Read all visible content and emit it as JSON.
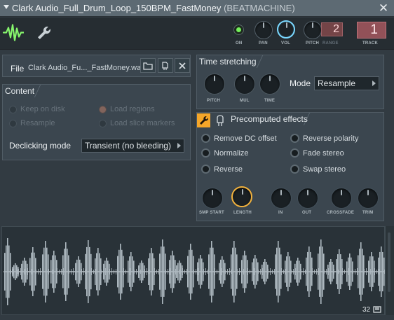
{
  "window": {
    "title": "Clark Audio_Full_Drum_Loop_150BPM_FastMoney",
    "subtitle": "(BEATMACHINE)",
    "close_symbol": "✕"
  },
  "topbar": {
    "on_label": "ON",
    "pan_label": "PAN",
    "vol_label": "VOL",
    "pitch_label": "PITCH",
    "range_label": "RANGE",
    "range_value": "2",
    "track_label": "TRACK",
    "track_value": "1",
    "icons": [
      "waveform-icon",
      "wrench-icon"
    ]
  },
  "file_panel": {
    "label": "File",
    "name": "Clark Audio_Fu..._FastMoney.wav",
    "buttons": [
      "folder-icon",
      "chip-icon",
      "close-icon"
    ]
  },
  "content_panel": {
    "title": "Content",
    "options": [
      {
        "label": "Keep on disk",
        "state": "disabled"
      },
      {
        "label": "Load regions",
        "state": "active-disabled"
      },
      {
        "label": "Resample",
        "state": "disabled"
      },
      {
        "label": "Load slice markers",
        "state": "disabled"
      }
    ],
    "declicking_label": "Declicking mode",
    "declicking_value": "Transient (no bleeding)"
  },
  "stretch_panel": {
    "title": "Time stretching",
    "knobs": [
      "PITCH",
      "MUL",
      "TIME"
    ],
    "mode_label": "Mode",
    "mode_value": "Resample"
  },
  "effects_panel": {
    "title": "Precomputed effects",
    "left_options": [
      "Remove DC offset",
      "Normalize",
      "Reverse"
    ],
    "right_options": [
      "Reverse polarity",
      "Fade stereo",
      "Swap stereo"
    ],
    "knobs": [
      "SMP START",
      "LENGTH",
      "IN",
      "OUT",
      "CROSSFADE",
      "TRIM"
    ]
  },
  "waveform": {
    "zoom_value": "32",
    "waveform_color": "#aeb9c0",
    "background_color": "#293238"
  },
  "colors": {
    "accent_green": "#74f05b",
    "accent_orange": "#f5a629",
    "track_red": "#925158",
    "range_red": "#744447",
    "vol_blue": "#7ad8ff"
  }
}
